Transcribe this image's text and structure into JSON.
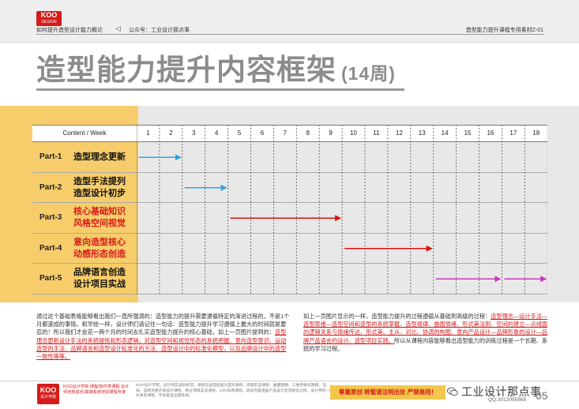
{
  "header": {
    "logo_text": "KOO",
    "logo_sub": "DESIGN",
    "left_text": "如何提升造型设计能力概论",
    "arrow": "◁",
    "center_text": "公众号：工业设计那点事",
    "right_text": "造型能力提升课程专用素材Z-01"
  },
  "title": {
    "main": "造型能力提升内容框架",
    "weeks": "(14周)"
  },
  "schedule": {
    "column_header": "Content / Week",
    "weeks": [
      "1",
      "2",
      "3",
      "4",
      "5",
      "6",
      "7",
      "8",
      "9",
      "10",
      "11",
      "12",
      "13",
      "14",
      "15",
      "16",
      "17",
      "18"
    ],
    "rows": [
      {
        "part": "Part-1",
        "lines": [
          "造型理念更新"
        ],
        "color": "#111111",
        "spans": [
          [
            1,
            2
          ]
        ],
        "arrow_color": "#2aa6e0"
      },
      {
        "part": "Part-2",
        "lines": [
          "造型手法提列",
          "造型设计初步"
        ],
        "color": "#111111",
        "spans": [
          [
            3,
            4
          ]
        ],
        "arrow_color": "#2aa6e0"
      },
      {
        "part": "Part-3",
        "lines": [
          "核心基础知识",
          "风格空间视觉"
        ],
        "color": "#d61a1a",
        "spans": [
          [
            5,
            9
          ]
        ],
        "arrow_color": "#e01010"
      },
      {
        "part": "Part-4",
        "lines": [
          "意向造型核心",
          "动感形态创造"
        ],
        "color": "#d61a1a",
        "spans": [
          [
            10,
            13
          ]
        ],
        "arrow_color": "#e01010"
      },
      {
        "part": "Part-5",
        "lines": [
          "品牌语言创造",
          "设计项目实战"
        ],
        "color": "#111111",
        "spans": [
          [
            14,
            16
          ],
          [
            17,
            18
          ]
        ],
        "arrow_color": "#c837c0"
      }
    ]
  },
  "paragraphs": {
    "left_plain": "通过这个基础表格能够看出我们一直所强调的：造型能力的提升需要遵循特定的渐进过程的，不是1个月都速成的事情。和学绘一样，设计师们请记住一句话：造型能力提升学习遵循上最大的时间就是要忍的！所以我们才会花一两个月的时间去扎实造型能力提升的核心基础，如上一页图片提到的：",
    "left_red": "造型理念更新设计手法的系统提炼和形态逻辑，对造型空间和视觉形态的系统把握、意向造型意识、运动造型的手法、品牌语言和造型设计标准化的方法、造型设计中的标准化模型，以及品牌设计中的造型一致性等等。",
    "right_plain": "如上一页图片显示的一样，造型能力提升的过程遵循从基础到高级的过程：",
    "right_red": "造型理念—设计手法—造型思维—造型空间和造型的系统掌握、造型规律、曲面情绪、形式美法则、空间的建立—点线面的逻辑关系与情绪传达、形式美、主从、对比、协调的构图、意向产品设计—品牌形象的设计—品牌产品语言的设计、造型项目实践。",
    "right_tail": "所以从课程内容能够看出造型能力的训练过程是一个长期、系统的学习过程。"
  },
  "footer": {
    "logo_text": "KOO",
    "logo_sub": "设计学院",
    "red_text": "KOO设计学院 课程/软件类课程 设计师自我成长/高端系统培训课程专家",
    "small_text": "KOO设计学院，设计师实战训练营，课程包含造型能力提升课程、高级形态课程、曲面建模、三维参数化建模、渲染、品牌风格开发设计课程、商业项目实战课程，1对1私教课程，培训内容涵盖产品设计全流程全过程，设计师统一成长体系课程，学员来自全国各地。",
    "ribbon": "尊重原创 转载请注明出处 严禁商用！",
    "brand": "工业设计那点事",
    "qq": "QQ:3012095868",
    "page": "05"
  },
  "colors": {
    "accent_yellow": "#f7cd6b",
    "brand_red": "#d61a1a",
    "arrow_blue": "#2aa6e0",
    "arrow_red": "#e01010",
    "arrow_purple": "#c837c0"
  }
}
